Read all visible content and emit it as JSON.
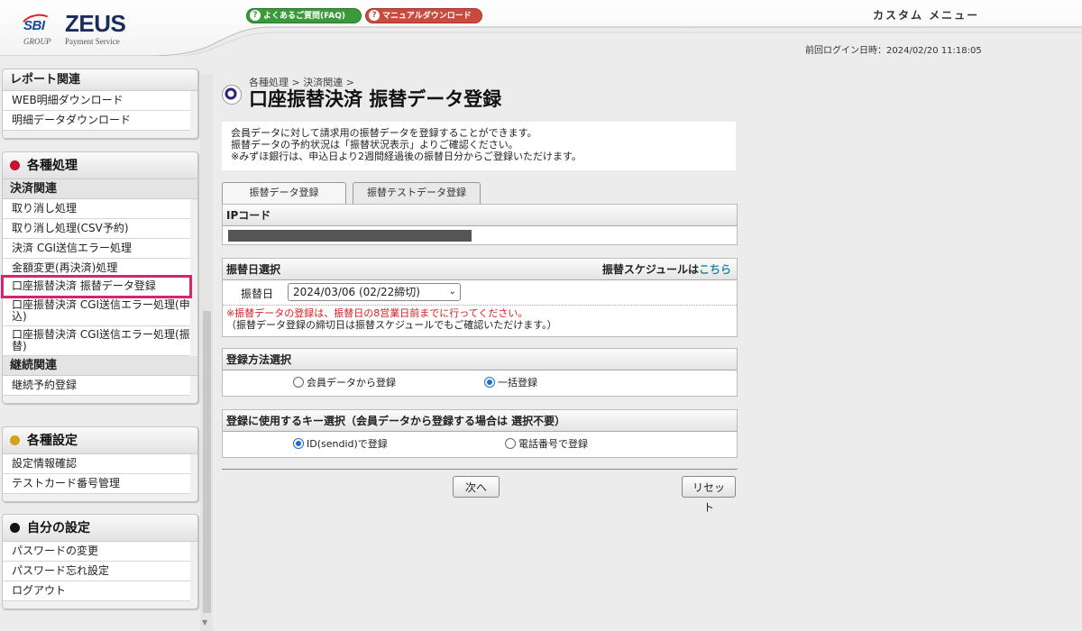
{
  "header": {
    "logo": {
      "sbi": "SBI",
      "zeus": "ZEUS",
      "group": "GROUP",
      "payment_service": "Payment Service"
    },
    "faq_label": "よくあるご質問(FAQ)",
    "manual_label": "マニュアルダウンロード",
    "custom_menu": "カスタム メニュー",
    "last_login": "前回ログイン日時：2024/02/20 11:18:05"
  },
  "sidebar": {
    "report": {
      "title": "レポート関連",
      "items": [
        "WEB明細ダウンロード",
        "明細データダウンロード"
      ]
    },
    "processing": {
      "title": "各種処理",
      "dot_color": "#c8102e",
      "sub_payment": "決済関連",
      "payment_items": [
        "取り消し処理",
        "取り消し処理(CSV予約)",
        "決済 CGI送信エラー処理",
        "金額変更(再決済)処理",
        "口座振替決済 振替データ登録",
        "口座振替決済 CGI送信エラー処理(申込)",
        "口座振替決済 CGI送信エラー処理(振替)"
      ],
      "sub_continuous": "継続関連",
      "continuous_items": [
        "継続予約登録"
      ]
    },
    "settings": {
      "title": "各種設定",
      "dot_color": "#d4a21a",
      "items": [
        "設定情報確認",
        "テストカード番号管理"
      ]
    },
    "my_settings": {
      "title": "自分の設定",
      "dot_color": "#111111",
      "items": [
        "パスワードの変更",
        "パスワード忘れ設定",
        "ログアウト"
      ]
    }
  },
  "main": {
    "breadcrumb": "各種処理 > 決済関連 >",
    "title": "口座振替決済 振替データ登録",
    "intro": [
      "会員データに対して請求用の振替データを登録することができます。",
      "振替データの予約状況は「振替状況表示」よりご確認ください。",
      "※みずほ銀行は、申込日より2週間経過後の振替日分からご登録いただけます。"
    ],
    "tabs": [
      "振替データ登録",
      "振替テストデータ登録"
    ],
    "ip_section": {
      "title": "IPコード"
    },
    "date_section": {
      "title": "振替日選択",
      "schedule_prefix": "振替スケジュールは",
      "schedule_link": "こちら",
      "label": "振替日",
      "selected": "2024/03/06 (02/22締切)",
      "warning": "※振替データの登録は、振替日の8営業日前までに行ってください。",
      "note": "（振替データ登録の締切日は振替スケジュールでもご確認いただけます。）"
    },
    "method_section": {
      "title": "登録方法選択",
      "options": [
        "会員データから登録",
        "一括登録"
      ],
      "selected_index": 1
    },
    "key_section": {
      "title": "登録に使用するキー選択（会員データから登録する場合は 選択不要）",
      "options": [
        "ID(sendid)で登録",
        "電話番号で登録"
      ],
      "selected_index": 0
    },
    "buttons": {
      "next": "次へ",
      "reset": "リセット"
    }
  }
}
